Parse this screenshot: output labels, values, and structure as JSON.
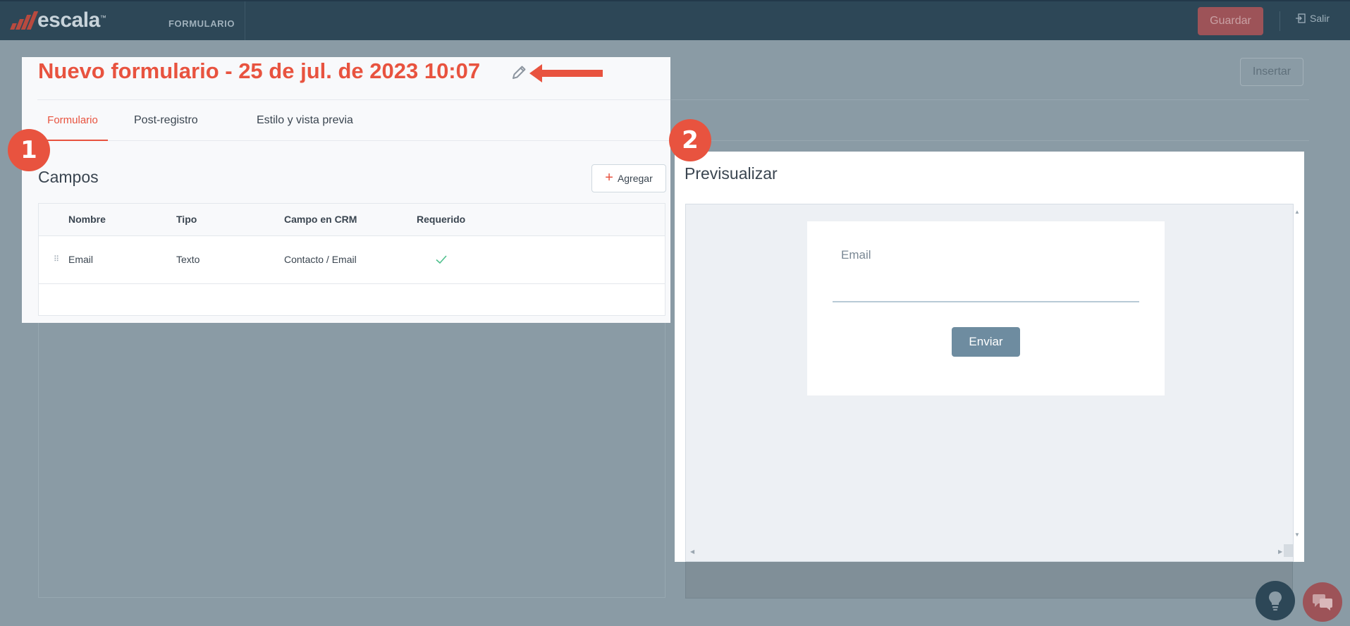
{
  "topbar": {
    "logo_text": "escala",
    "logo_tm": "™",
    "section_label": "FORMULARIO",
    "save_label": "Guardar",
    "exit_label": "Salir"
  },
  "background": {
    "insert_label": "Insertar"
  },
  "form": {
    "title": "Nuevo formulario - 25 de jul. de 2023 10:07",
    "tabs": [
      {
        "label": "Formulario",
        "active": true
      },
      {
        "label": "Post-registro",
        "active": false
      },
      {
        "label": "Estilo y vista previa",
        "active": false
      }
    ],
    "fields_title": "Campos",
    "add_label": "Agregar",
    "table": {
      "headers": [
        "Nombre",
        "Tipo",
        "Campo en CRM",
        "Requerido"
      ],
      "rows": [
        {
          "nombre": "Email",
          "tipo": "Texto",
          "campo_crm": "Contacto / Email",
          "requerido": true
        }
      ]
    }
  },
  "badges": {
    "one": "1",
    "two": "2"
  },
  "preview": {
    "title": "Previsualizar",
    "field_label": "Email",
    "submit_label": "Enviar"
  },
  "colors": {
    "accent": "#e8533f",
    "topbar": "#2d4757",
    "overlay": "#8a9ba5",
    "submit_button": "#6e8ca0",
    "check": "#4fc08d"
  },
  "icons": {
    "edit": "pencil-icon",
    "arrow": "arrow-left-icon",
    "add": "plus-icon",
    "exit": "exit-icon",
    "drag": "drag-handle-icon",
    "check": "check-icon",
    "help": "lightbulb-icon",
    "chat": "chat-icon"
  }
}
